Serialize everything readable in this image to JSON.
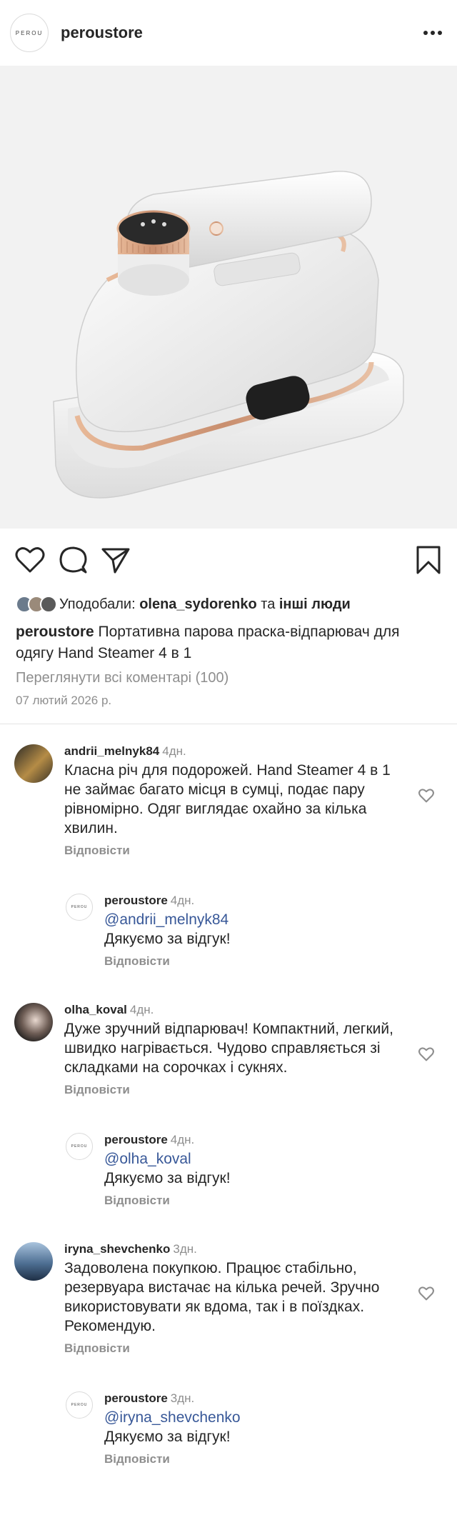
{
  "header": {
    "logo_text": "PEROU",
    "username": "peroustore",
    "more_icon": "more-dots-icon"
  },
  "post": {
    "image_alt": "Hand Steamer 4 в 1",
    "actions": {
      "like_icon": "heart-icon",
      "comment_icon": "comment-bubble-icon",
      "share_icon": "paper-plane-icon",
      "save_icon": "bookmark-icon"
    },
    "likes": {
      "prefix": "Уподобали: ",
      "user": "olena_sydorenko",
      "middle": " та ",
      "others": "інші люди"
    },
    "caption": {
      "user": "peroustore",
      "text": " Портативна парова праска-відпарювач для одягу Hand Steamer 4 в 1"
    },
    "view_comments": "Переглянути всі коментарі (100)",
    "date": "07 лютий 2026 р."
  },
  "comments": [
    {
      "user": "andrii_melnyk84",
      "time": "4дн.",
      "text": "Класна річ для подорожей. Hand Steamer 4 в 1 не займає багато місця в сумці, подає пару рівномірно. Одяг виглядає охайно за кілька хвилин.",
      "reply_label": "Відповісти",
      "reply": {
        "user": "peroustore",
        "time": "4дн.",
        "mention": "@andrii_melnyk84",
        "text": "Дякуємо за відгук!",
        "reply_label": "Відповісти",
        "logo_text": "PEROU"
      }
    },
    {
      "user": "olha_koval",
      "time": "4дн.",
      "text": "Дуже зручний відпарювач! Компактний, легкий, швидко нагрівається. Чудово справляється зі складками на сорочках і сукнях.",
      "reply_label": "Відповісти",
      "reply": {
        "user": "peroustore",
        "time": "4дн.",
        "mention": "@olha_koval",
        "text": "Дякуємо за відгук!",
        "reply_label": "Відповісти",
        "logo_text": "PEROU"
      }
    },
    {
      "user": "iryna_shevchenko",
      "time": "3дн.",
      "text": "Задоволена покупкою. Працює стабільно, резервуара вистачає на кілька речей. Зручно використовувати як вдома, так і в поїздках. Рекомендую.",
      "reply_label": "Відповісти",
      "reply": {
        "user": "peroustore",
        "time": "3дн.",
        "mention": "@iryna_shevchenko",
        "text": "Дякуємо за відгук!",
        "reply_label": "Відповісти",
        "logo_text": "PEROU"
      }
    }
  ],
  "colors": {
    "accent_rose_gold": "#c98f6f",
    "mention_blue": "#385898",
    "muted_gray": "#8e8e8e"
  }
}
